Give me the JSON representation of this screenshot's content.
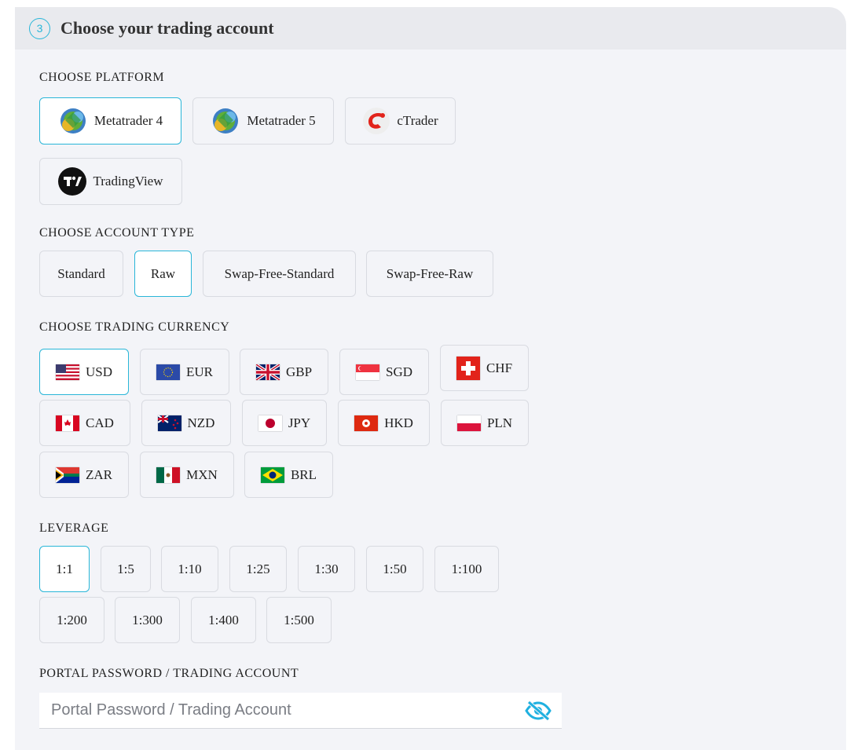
{
  "header": {
    "step": "3",
    "title": "Choose your trading account"
  },
  "platform": {
    "label": "CHOOSE PLATFORM",
    "options": [
      "Metatrader 4",
      "Metatrader 5",
      "cTrader",
      "TradingView"
    ],
    "selected": "Metatrader 4"
  },
  "account_type": {
    "label": "CHOOSE ACCOUNT TYPE",
    "options": [
      "Standard",
      "Raw",
      "Swap-Free-Standard",
      "Swap-Free-Raw"
    ],
    "selected": "Raw"
  },
  "currency": {
    "label": "CHOOSE TRADING CURRENCY",
    "options": [
      "USD",
      "EUR",
      "GBP",
      "SGD",
      "CHF",
      "CAD",
      "NZD",
      "JPY",
      "HKD",
      "PLN",
      "ZAR",
      "MXN",
      "BRL"
    ],
    "selected": "USD"
  },
  "leverage": {
    "label": "LEVERAGE",
    "options": [
      "1:1",
      "1:5",
      "1:10",
      "1:25",
      "1:30",
      "1:50",
      "1:100",
      "1:200",
      "1:300",
      "1:400",
      "1:500"
    ],
    "selected": "1:1"
  },
  "password": {
    "label": "PORTAL PASSWORD / TRADING ACCOUNT",
    "placeholder": "Portal Password / Trading Account",
    "value": ""
  },
  "colors": {
    "accent": "#29b6d8",
    "panel": "#f3f4f8",
    "header": "#e9eaee"
  }
}
